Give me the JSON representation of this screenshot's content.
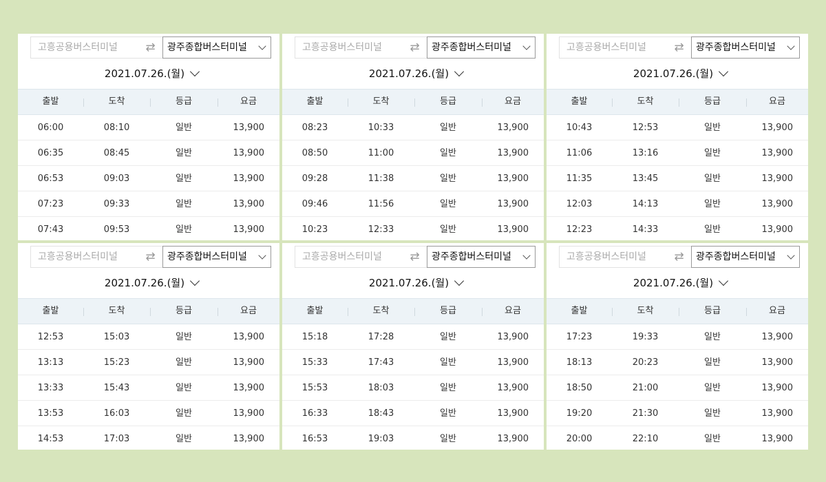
{
  "departure_placeholder": "고흥공용버스터미널",
  "arrival_terminal": "광주종합버스터미널",
  "date": "2021.07.26.(월)",
  "columns": [
    "출발",
    "도착",
    "등급",
    "요금"
  ],
  "icons": {
    "swap": "swap-arrows-icon",
    "dropdown": "chevron-down-icon"
  },
  "panels": [
    {
      "rows": [
        [
          "06:00",
          "08:10",
          "일반",
          "13,900"
        ],
        [
          "06:35",
          "08:45",
          "일반",
          "13,900"
        ],
        [
          "06:53",
          "09:03",
          "일반",
          "13,900"
        ],
        [
          "07:23",
          "09:33",
          "일반",
          "13,900"
        ],
        [
          "07:43",
          "09:53",
          "일반",
          "13,900"
        ]
      ]
    },
    {
      "rows": [
        [
          "08:23",
          "10:33",
          "일반",
          "13,900"
        ],
        [
          "08:50",
          "11:00",
          "일반",
          "13,900"
        ],
        [
          "09:28",
          "11:38",
          "일반",
          "13,900"
        ],
        [
          "09:46",
          "11:56",
          "일반",
          "13,900"
        ],
        [
          "10:23",
          "12:33",
          "일반",
          "13,900"
        ]
      ]
    },
    {
      "rows": [
        [
          "10:43",
          "12:53",
          "일반",
          "13,900"
        ],
        [
          "11:06",
          "13:16",
          "일반",
          "13,900"
        ],
        [
          "11:35",
          "13:45",
          "일반",
          "13,900"
        ],
        [
          "12:03",
          "14:13",
          "일반",
          "13,900"
        ],
        [
          "12:23",
          "14:33",
          "일반",
          "13,900"
        ]
      ]
    },
    {
      "rows": [
        [
          "12:53",
          "15:03",
          "일반",
          "13,900"
        ],
        [
          "13:13",
          "15:23",
          "일반",
          "13,900"
        ],
        [
          "13:33",
          "15:43",
          "일반",
          "13,900"
        ],
        [
          "13:53",
          "16:03",
          "일반",
          "13,900"
        ],
        [
          "14:53",
          "17:03",
          "일반",
          "13,900"
        ]
      ]
    },
    {
      "rows": [
        [
          "15:18",
          "17:28",
          "일반",
          "13,900"
        ],
        [
          "15:33",
          "17:43",
          "일반",
          "13,900"
        ],
        [
          "15:53",
          "18:03",
          "일반",
          "13,900"
        ],
        [
          "16:33",
          "18:43",
          "일반",
          "13,900"
        ],
        [
          "16:53",
          "19:03",
          "일반",
          "13,900"
        ]
      ]
    },
    {
      "rows": [
        [
          "17:23",
          "19:33",
          "일반",
          "13,900"
        ],
        [
          "18:13",
          "20:23",
          "일반",
          "13,900"
        ],
        [
          "18:50",
          "21:00",
          "일반",
          "13,900"
        ],
        [
          "19:20",
          "21:30",
          "일반",
          "13,900"
        ],
        [
          "20:00",
          "22:10",
          "일반",
          "13,900"
        ]
      ]
    }
  ]
}
